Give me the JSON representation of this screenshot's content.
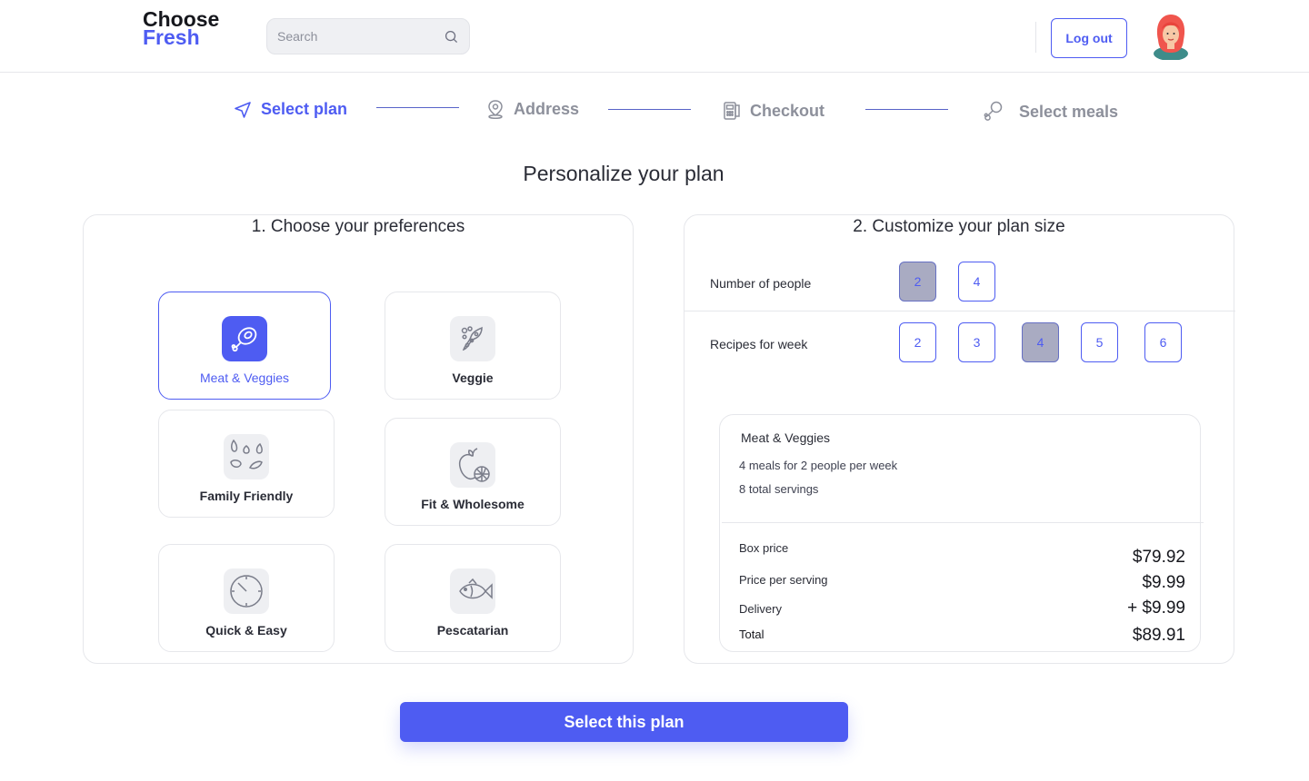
{
  "brand": {
    "line1": "Choose",
    "line2": "Fresh"
  },
  "search": {
    "placeholder": "Search",
    "icon": "search-icon"
  },
  "header": {
    "logout_label": "Log out"
  },
  "steps": [
    {
      "label": "Select plan",
      "icon": "navigation-arrow-icon",
      "active": true
    },
    {
      "label": "Address",
      "icon": "location-pin-icon",
      "active": false
    },
    {
      "label": "Checkout",
      "icon": "card-terminal-icon",
      "active": false
    },
    {
      "label": "Select meals",
      "icon": "drumstick-icon",
      "active": false
    }
  ],
  "page": {
    "title": "Personalize your plan"
  },
  "preferences": {
    "title": "1. Choose your preferences",
    "options": [
      {
        "label": "Meat & Veggies",
        "icon": "meat-icon",
        "selected": true
      },
      {
        "label": "Veggie",
        "icon": "pea-pod-icon",
        "selected": false
      },
      {
        "label": "Family Friendly",
        "icon": "seeds-icon",
        "selected": false
      },
      {
        "label": "Fit & Wholesome",
        "icon": "apple-citrus-icon",
        "selected": false
      },
      {
        "label": "Quick & Easy",
        "icon": "clock-icon",
        "selected": false
      },
      {
        "label": "Pescatarian",
        "icon": "fish-icon",
        "selected": false
      }
    ]
  },
  "plan_size": {
    "title": "2. Customize your plan size",
    "people": {
      "label": "Number of people",
      "options": [
        "2",
        "4"
      ],
      "selected": "2"
    },
    "recipes": {
      "label": "Recipes for week",
      "options": [
        "2",
        "3",
        "4",
        "5",
        "6"
      ],
      "selected": "4"
    }
  },
  "summary": {
    "plan_name": "Meat & Veggies",
    "line1": "4 meals for 2 people per week",
    "line2": "8 total servings",
    "rows": [
      {
        "label": "Box price",
        "value": "$79.92"
      },
      {
        "label": "Price per serving",
        "value": "$9.99"
      },
      {
        "label": "Delivery",
        "value": "+ $9.99"
      },
      {
        "label": "Total",
        "value": "$89.91"
      }
    ]
  },
  "cta": {
    "label": "Select this plan"
  },
  "colors": {
    "accent": "#4e5cf2",
    "selected_fill": "#a9abc2",
    "border": "#e6e7eb",
    "text": "#2a2c36"
  }
}
